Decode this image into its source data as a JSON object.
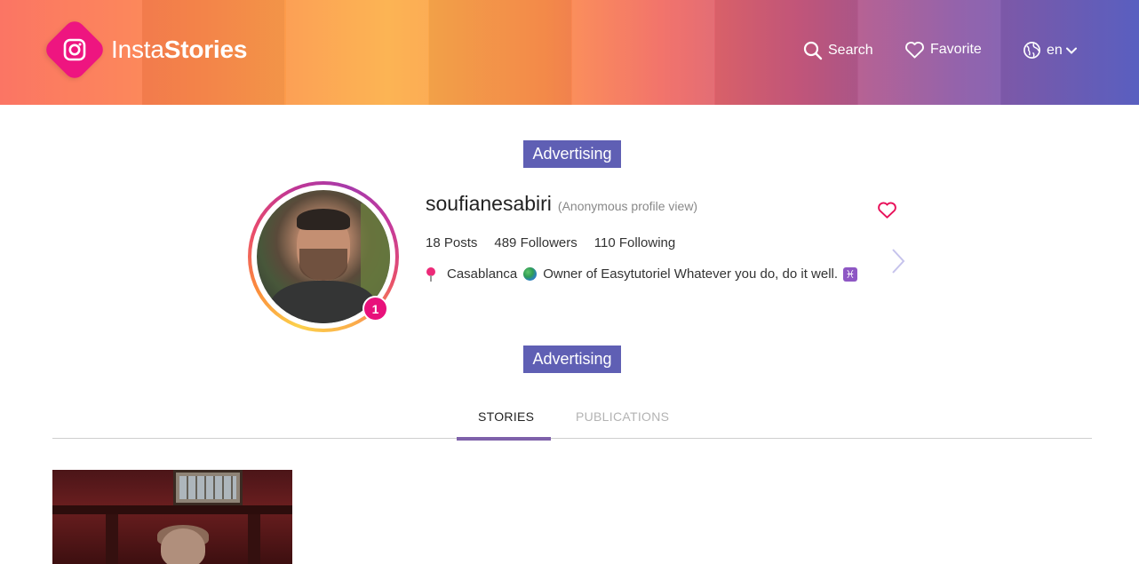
{
  "header": {
    "logo_text_light": "Insta",
    "logo_text_bold": "Stories",
    "search_label": "Search",
    "favorite_label": "Favorite",
    "language_label": "en"
  },
  "ads": {
    "top_label": "Advertising",
    "bottom_label": "Advertising"
  },
  "profile": {
    "username": "soufianesabiri",
    "anonymous_note": "(Anonymous profile view)",
    "story_count": "1",
    "posts": "18 Posts",
    "followers": "489 Followers",
    "following": "110 Following",
    "bio_location": "Casablanca",
    "bio_text": "Owner of Easytutoriel Whatever you do, do it well.",
    "bio_emoji_pisces": "♓"
  },
  "tabs": [
    {
      "label": "STORIES",
      "active": true
    },
    {
      "label": "PUBLICATIONS",
      "active": false
    }
  ],
  "colors": {
    "accent": "#5f5fb4",
    "brand_pink": "#ee1580",
    "tab_underline": "#7e61aa",
    "heart": "#e8115a"
  },
  "icons": {
    "search": "search-icon",
    "favorite": "heart-outline-icon",
    "language": "globe-icon",
    "dropdown": "chevron-down-icon",
    "next": "chevron-right-icon"
  }
}
